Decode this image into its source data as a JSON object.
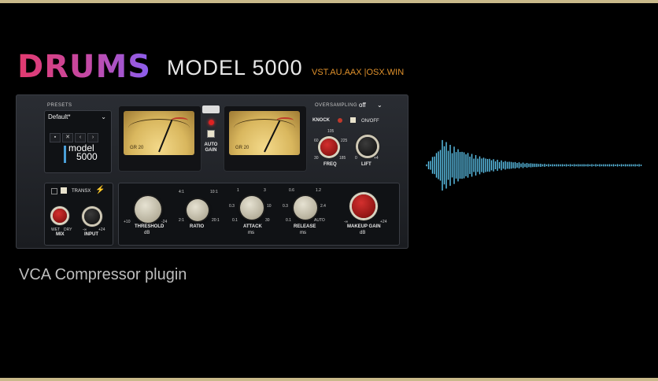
{
  "header": {
    "title": "DRUMS",
    "model": "MODEL 5000",
    "formats": "VST.AU.AAX |OSX.WIN"
  },
  "subtitle": "VCA Compressor plugin",
  "plugin": {
    "presets_label": "PRESETS",
    "preset_value": "Default*",
    "oversampling_label": "OVERSAMPLING",
    "oversampling_value": "off",
    "logo_line1": "model",
    "logo_line2": "5000",
    "meter_gr": "GR 20",
    "auto_gain": "AUTO GAIN",
    "knock": "KNOCK",
    "on_off": "ON/OFF",
    "freq": {
      "label": "FREQ",
      "ticks": [
        "105",
        "60",
        "225",
        "30",
        "185"
      ]
    },
    "lift": {
      "label": "LIFT",
      "ticks": [
        "0",
        "+4"
      ]
    },
    "transx": "TRANSX",
    "mix": {
      "label": "MIX",
      "ticks": [
        "WET",
        "DRY"
      ]
    },
    "input": {
      "label": "INPUT",
      "ticks": [
        "-∞",
        "+24"
      ]
    },
    "threshold": {
      "label": "THRESHOLD",
      "unit": "dB",
      "ticks": [
        "+10",
        "-24"
      ]
    },
    "ratio": {
      "label": "RATIO",
      "ticks": [
        "4:1",
        "10:1",
        "2:1",
        "20:1"
      ]
    },
    "attack": {
      "label": "ATTACK",
      "unit": "ms",
      "ticks": [
        "1",
        "3",
        "0.3",
        "10",
        "0.1",
        "30"
      ]
    },
    "release": {
      "label": "RELEASE",
      "unit": "ms",
      "ticks": [
        "0.6",
        "1.2",
        "0.3",
        "2.4",
        "0.1",
        "AUTO"
      ]
    },
    "makeup": {
      "label": "MAKEUP GAIN",
      "unit": "dB",
      "ticks": [
        "-∞",
        "+24"
      ]
    }
  },
  "colors": {
    "accent_pink": "#e23a6e",
    "accent_purple": "#8a5ff0",
    "formats_orange": "#e0912b",
    "waveform": "#5fc7f0"
  }
}
